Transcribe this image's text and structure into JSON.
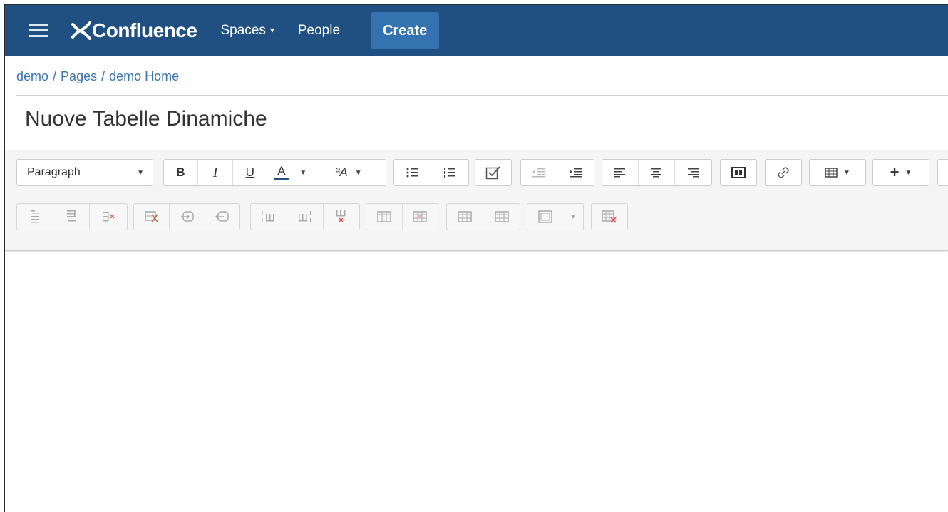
{
  "header": {
    "logo_text": "Confluence",
    "spaces_label": "Spaces",
    "people_label": "People",
    "create_label": "Create"
  },
  "breadcrumb": {
    "items": [
      "demo",
      "Pages",
      "demo Home"
    ],
    "separator": "/"
  },
  "page": {
    "title": "Nuove Tabelle Dinamiche"
  },
  "toolbar": {
    "paragraph_label": "Paragraph",
    "bold_label": "B",
    "italic_label": "I",
    "underline_label": "U",
    "color_label": "A",
    "format_label": "ªA"
  },
  "colors": {
    "header_bg": "#205081",
    "create_bg": "#3572b0",
    "link": "#3b73af"
  }
}
